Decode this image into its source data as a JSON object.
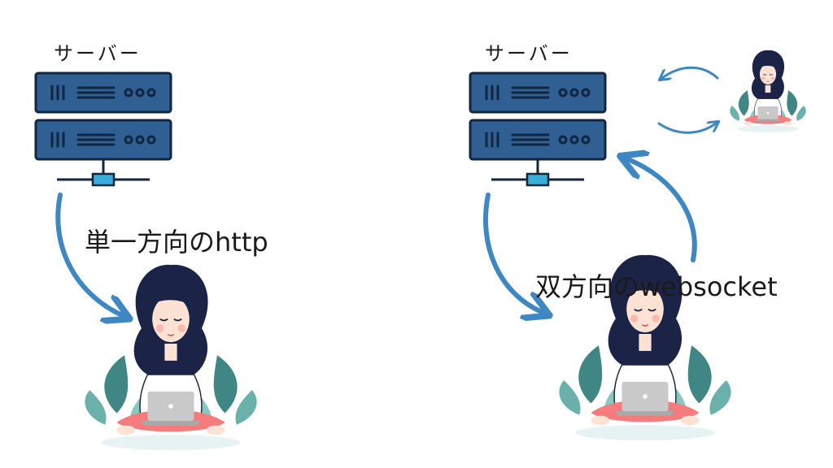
{
  "left": {
    "server_label": "サーバー",
    "caption": "単一方向のhttp"
  },
  "right": {
    "server_label": "サーバー",
    "caption": "双方向のwebsocket"
  },
  "colors": {
    "server_body": "#2f5f93",
    "server_outline": "#12263f",
    "connector": "#3aaed8",
    "arrow": "#3d87c2",
    "hair": "#1b2347",
    "skin": "#fde2d3",
    "pants": "#f47c7c",
    "laptop": "#c9c9c9",
    "leaves": "#2c7a77"
  },
  "icons": [
    "server-icon",
    "user-with-laptop-icon",
    "arrow-icon"
  ]
}
